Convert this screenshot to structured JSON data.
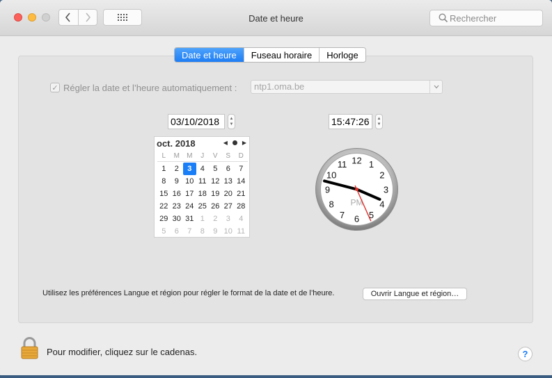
{
  "window": {
    "title": "Date et heure",
    "search_placeholder": "Rechercher"
  },
  "tabs": [
    {
      "label": "Date et heure",
      "active": true
    },
    {
      "label": "Fuseau horaire",
      "active": false
    },
    {
      "label": "Horloge",
      "active": false
    }
  ],
  "auto": {
    "label": "Régler la date et l’heure automatiquement :",
    "checked": true,
    "server": "ntp1.oma.be"
  },
  "date_field": "03/10/2018",
  "time_field": "15:47:26",
  "calendar": {
    "month_label": "oct. 2018",
    "weekdays": [
      "L",
      "M",
      "M",
      "J",
      "V",
      "S",
      "D"
    ],
    "days": [
      [
        "1",
        "2",
        "3",
        "4",
        "5",
        "6",
        "7"
      ],
      [
        "8",
        "9",
        "10",
        "11",
        "12",
        "13",
        "14"
      ],
      [
        "15",
        "16",
        "17",
        "18",
        "19",
        "20",
        "21"
      ],
      [
        "22",
        "23",
        "24",
        "25",
        "26",
        "27",
        "28"
      ],
      [
        "29",
        "30",
        "31",
        "1",
        "2",
        "3",
        "4"
      ],
      [
        "5",
        "6",
        "7",
        "8",
        "9",
        "10",
        "11"
      ]
    ],
    "selected_day": "3"
  },
  "clock": {
    "numerals": [
      "12",
      "1",
      "2",
      "3",
      "4",
      "5",
      "6",
      "7",
      "8",
      "9",
      "10",
      "11"
    ],
    "period": "PM",
    "hours": 15,
    "minutes": 47,
    "seconds": 26
  },
  "hint": "Utilisez les préférences Langue et région pour régler le format de la date et de l’heure.",
  "open_button": "Ouvrir Langue et région…",
  "lock_text": "Pour modifier, cliquez sur le cadenas.",
  "help": "?",
  "colors": {
    "accent": "#1a7ef7",
    "second_hand": "#e0302a"
  }
}
